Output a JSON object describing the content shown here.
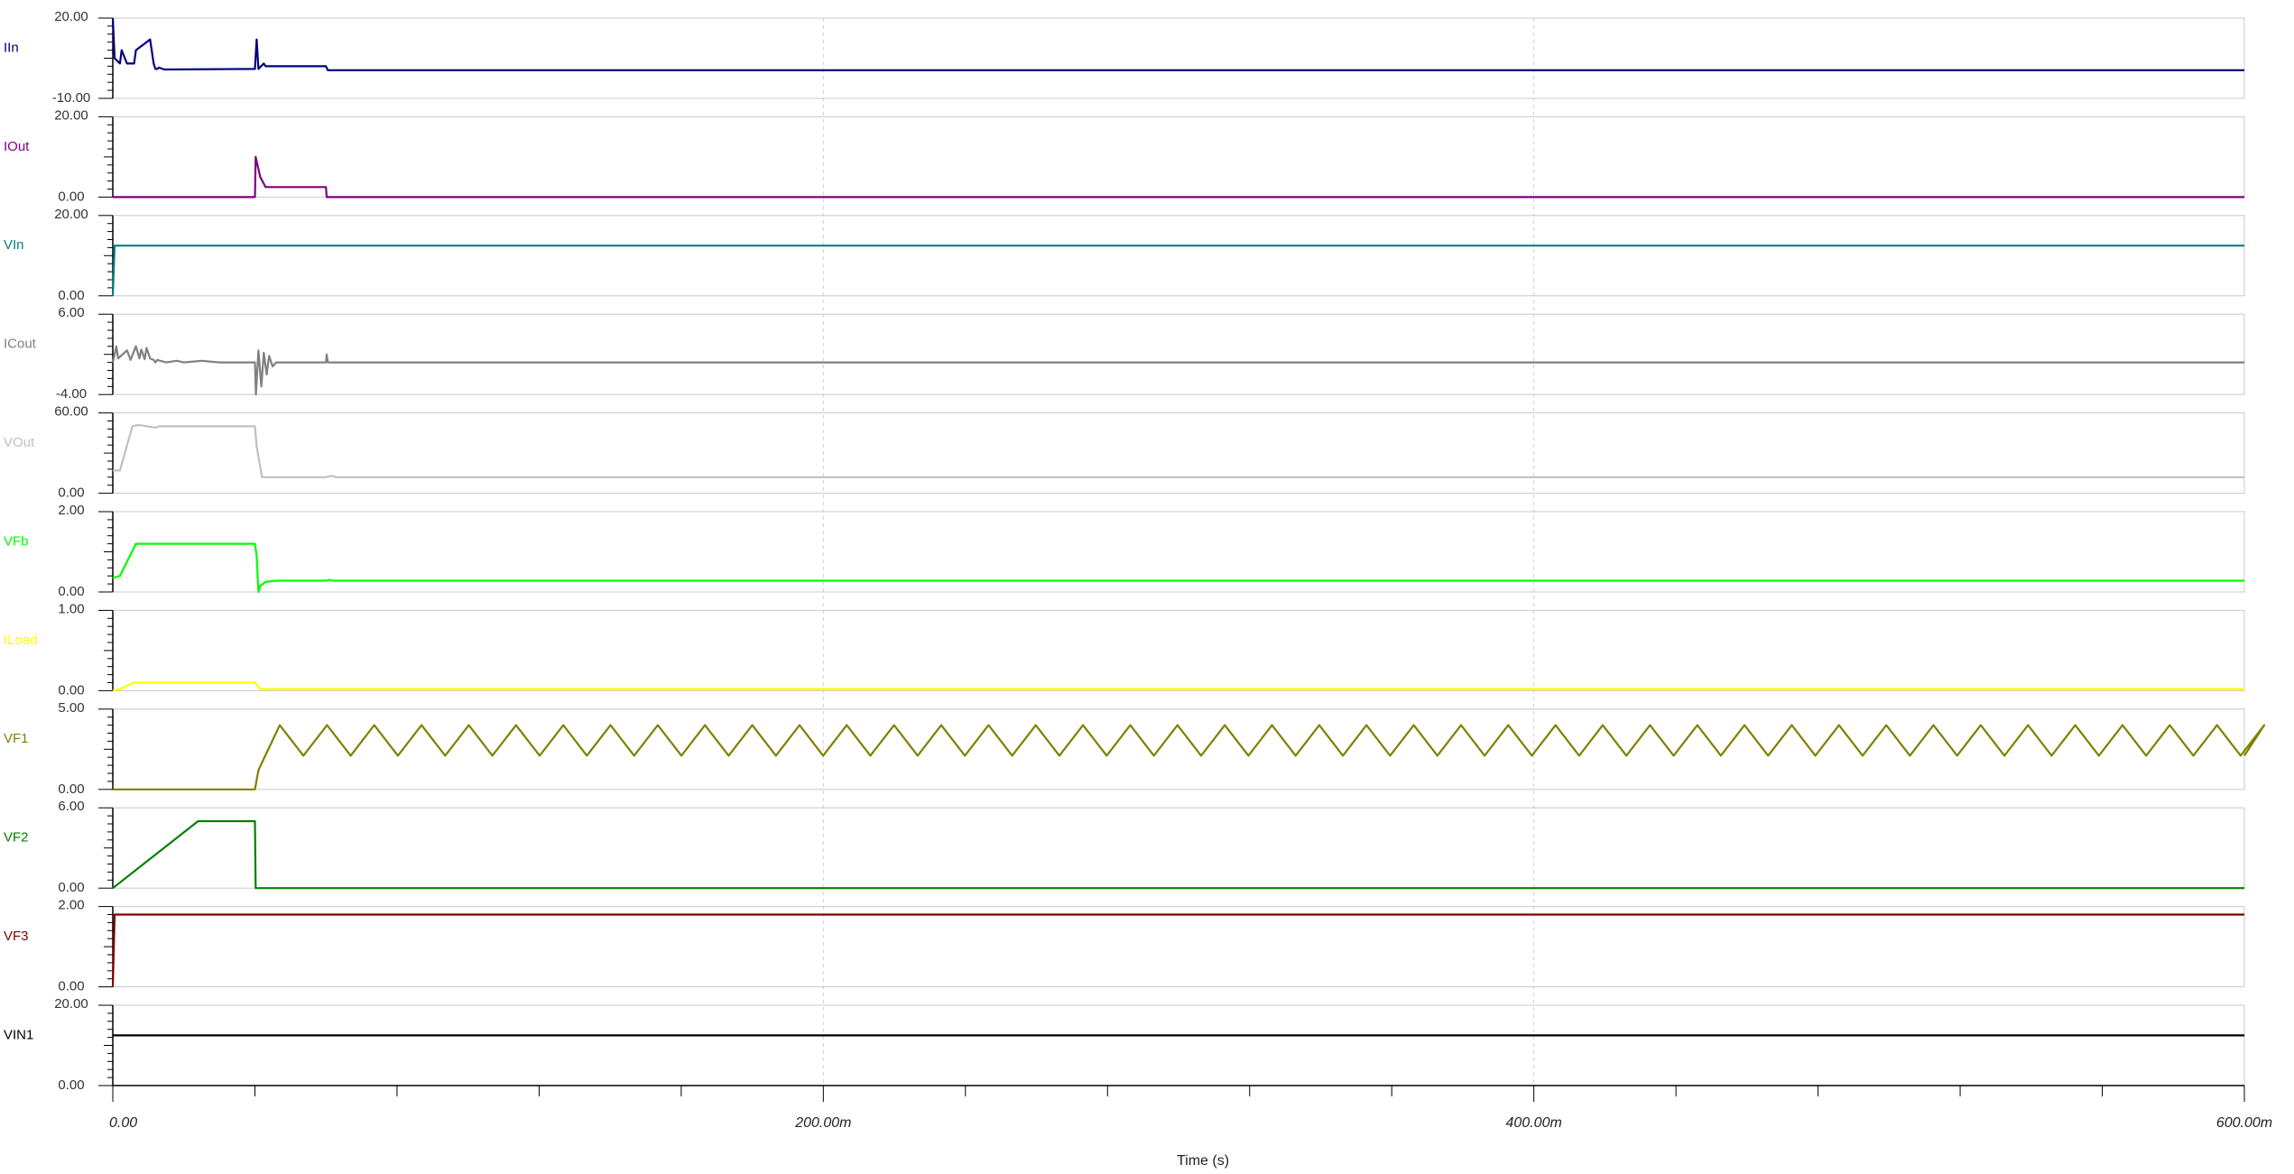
{
  "chart_data": {
    "type": "line",
    "xlabel": "Time (s)",
    "x_range": [
      0,
      0.6
    ],
    "x_ticks": [
      {
        "value": 0,
        "label": "0.00"
      },
      {
        "value": 0.2,
        "label": "200.00m"
      },
      {
        "value": 0.4,
        "label": "400.00m"
      },
      {
        "value": 0.6,
        "label": "600.00m"
      }
    ],
    "grid": "vertical dotted at major x ticks",
    "panels": [
      {
        "name": "IIn",
        "color": "#000080",
        "ylim": [
          -10,
          20
        ],
        "ytick_labels": [
          "20.00",
          "-10.00"
        ],
        "points": [
          [
            0,
            20
          ],
          [
            0.0005,
            5
          ],
          [
            0.002,
            3
          ],
          [
            0.0025,
            8
          ],
          [
            0.004,
            3
          ],
          [
            0.006,
            3
          ],
          [
            0.0065,
            8
          ],
          [
            0.0075,
            9
          ],
          [
            0.0085,
            10
          ],
          [
            0.0095,
            11
          ],
          [
            0.0105,
            12
          ],
          [
            0.0115,
            3
          ],
          [
            0.012,
            1
          ],
          [
            0.0125,
            1
          ],
          [
            0.013,
            1.5
          ],
          [
            0.0145,
            0.8
          ],
          [
            0.04,
            1
          ],
          [
            0.0405,
            12
          ],
          [
            0.041,
            1
          ],
          [
            0.0425,
            3
          ],
          [
            0.043,
            2
          ],
          [
            0.06,
            2
          ],
          [
            0.0605,
            0.5
          ],
          [
            0.6,
            0.5
          ]
        ]
      },
      {
        "name": "IOut",
        "color": "#800080",
        "ylim": [
          0,
          20
        ],
        "ytick_labels": [
          "20.00",
          "0.00"
        ],
        "points": [
          [
            0,
            0
          ],
          [
            0.04,
            0
          ],
          [
            0.0402,
            10
          ],
          [
            0.0415,
            5
          ],
          [
            0.043,
            2.5
          ],
          [
            0.06,
            2.5
          ],
          [
            0.0602,
            0
          ],
          [
            0.6,
            0
          ]
        ]
      },
      {
        "name": "VIn",
        "color": "#008080",
        "ylim": [
          0,
          20
        ],
        "ytick_labels": [
          "20.00",
          "0.00"
        ],
        "points": [
          [
            0,
            0
          ],
          [
            0.0005,
            12.5
          ],
          [
            0.6,
            12.5
          ]
        ]
      },
      {
        "name": "ICout",
        "color": "#808080",
        "ylim": [
          -4,
          6
        ],
        "ytick_labels": [
          "6.00",
          "-4.00"
        ],
        "points": [
          [
            0,
            0
          ],
          [
            0.001,
            2
          ],
          [
            0.0015,
            0.5
          ],
          [
            0.004,
            1.5
          ],
          [
            0.005,
            0.3
          ],
          [
            0.0065,
            2
          ],
          [
            0.0075,
            0.5
          ],
          [
            0.008,
            1.6
          ],
          [
            0.009,
            0.4
          ],
          [
            0.0095,
            1.8
          ],
          [
            0.0105,
            0.5
          ],
          [
            0.0115,
            0.3
          ],
          [
            0.012,
            0
          ],
          [
            0.0125,
            0.3
          ],
          [
            0.015,
            0
          ],
          [
            0.018,
            0.2
          ],
          [
            0.02,
            0
          ],
          [
            0.025,
            0.2
          ],
          [
            0.03,
            0
          ],
          [
            0.04,
            0
          ],
          [
            0.0403,
            -4
          ],
          [
            0.041,
            1.5
          ],
          [
            0.0418,
            -3
          ],
          [
            0.0425,
            1.2
          ],
          [
            0.0433,
            -1.5
          ],
          [
            0.044,
            0.8
          ],
          [
            0.045,
            -0.5
          ],
          [
            0.046,
            0
          ],
          [
            0.06,
            0
          ],
          [
            0.0602,
            1
          ],
          [
            0.0605,
            0
          ],
          [
            0.6,
            0
          ]
        ]
      },
      {
        "name": "VOut",
        "color": "#C0C0C0",
        "ylim": [
          0,
          60
        ],
        "ytick_labels": [
          "60.00",
          "0.00"
        ],
        "points": [
          [
            0,
            17
          ],
          [
            0.002,
            17
          ],
          [
            0.0055,
            50
          ],
          [
            0.007,
            51
          ],
          [
            0.0085,
            50.5
          ],
          [
            0.012,
            49
          ],
          [
            0.013,
            50
          ],
          [
            0.04,
            50
          ],
          [
            0.0405,
            35
          ],
          [
            0.042,
            12
          ],
          [
            0.06,
            12
          ],
          [
            0.0615,
            13
          ],
          [
            0.063,
            12
          ],
          [
            0.6,
            12
          ]
        ]
      },
      {
        "name": "VFb",
        "color": "#00FF00",
        "ylim": [
          0,
          2
        ],
        "ytick_labels": [
          "2.00",
          "0.00"
        ],
        "points": [
          [
            0,
            0.35
          ],
          [
            0.002,
            0.4
          ],
          [
            0.0065,
            1.2
          ],
          [
            0.04,
            1.2
          ],
          [
            0.0405,
            0.9
          ],
          [
            0.041,
            0
          ],
          [
            0.0415,
            0.15
          ],
          [
            0.043,
            0.25
          ],
          [
            0.046,
            0.28
          ],
          [
            0.06,
            0.28
          ],
          [
            0.061,
            0.3
          ],
          [
            0.062,
            0.28
          ],
          [
            0.6,
            0.28
          ]
        ]
      },
      {
        "name": "ILoad",
        "color": "#FFFF00",
        "ylim": [
          0,
          1
        ],
        "ytick_labels": [
          "1.00",
          "0.00"
        ],
        "points": [
          [
            0,
            0
          ],
          [
            0.002,
            0.02
          ],
          [
            0.006,
            0.1
          ],
          [
            0.04,
            0.1
          ],
          [
            0.0415,
            0.02
          ],
          [
            0.6,
            0.02
          ]
        ]
      },
      {
        "name": "VF1",
        "color": "#808000",
        "ylim": [
          0,
          5
        ],
        "ytick_labels": [
          "5.00",
          "0.00"
        ],
        "points": [
          [
            0,
            0
          ],
          [
            0.04,
            0
          ],
          [
            0.041,
            1.2
          ],
          [
            0.047,
            4
          ]
        ]
      },
      {
        "name": "VF2",
        "color": "#008000",
        "ylim": [
          0,
          6
        ],
        "ytick_labels": [
          "6.00",
          "0.00"
        ],
        "points": [
          [
            0,
            0
          ],
          [
            0.024,
            5
          ],
          [
            0.04,
            5
          ],
          [
            0.0402,
            0
          ],
          [
            0.6,
            0
          ]
        ]
      },
      {
        "name": "VF3",
        "color": "#800000",
        "ylim": [
          0,
          2
        ],
        "ytick_labels": [
          "2.00",
          "0.00"
        ],
        "points": [
          [
            0,
            0
          ],
          [
            0.0005,
            1.8
          ],
          [
            0.6,
            1.8
          ]
        ]
      },
      {
        "name": "VIN1",
        "color": "#000000",
        "ylim": [
          0,
          20
        ],
        "ytick_labels": [
          "20.00",
          "0.00"
        ],
        "points": [
          [
            0,
            12.5
          ],
          [
            0.6,
            12.5
          ]
        ]
      }
    ]
  }
}
